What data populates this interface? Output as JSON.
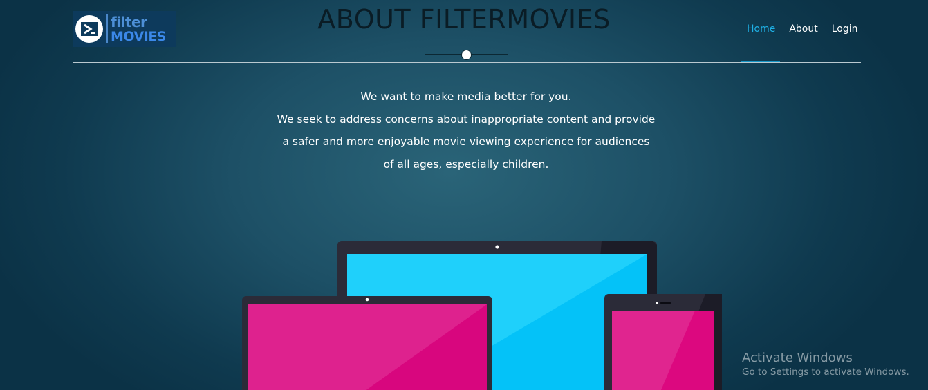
{
  "logo": {
    "line1": "filter",
    "line2": "MOVIES"
  },
  "page": {
    "title": "ABOUT FILTERMOVIES"
  },
  "nav": [
    {
      "label": "Home",
      "active": true
    },
    {
      "label": "About",
      "active": false
    },
    {
      "label": "Login",
      "active": false
    }
  ],
  "intro": {
    "line1": "We want to make media better for you.",
    "line2": "We seek to address concerns about inappropriate content and provide a safer and more enjoyable movie viewing experience for audiences of all ages, especially children."
  },
  "colors": {
    "accent": "#1fb1e6",
    "screen_blue": "#04c2f8",
    "screen_pink": "#dc087f"
  },
  "watermark": {
    "title": "Activate Windows",
    "subtitle": "Go to Settings to activate Windows."
  }
}
